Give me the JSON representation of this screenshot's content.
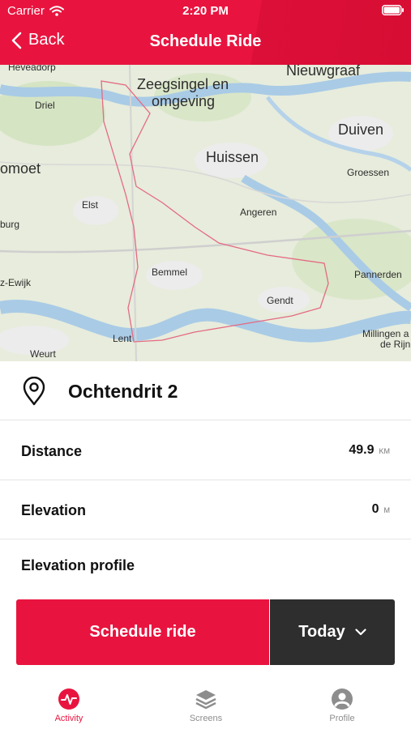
{
  "status_bar": {
    "carrier": "Carrier",
    "time": "2:20 PM"
  },
  "nav": {
    "back_label": "Back",
    "title": "Schedule Ride"
  },
  "map": {
    "places": [
      "Heveadorp",
      "Zeegsingel en",
      "omgeving",
      "Nieuwgraaf",
      "Driel",
      "Duiven",
      "omoet",
      "Huissen",
      "Groessen",
      "Elst",
      "Angeren",
      "burg",
      "Bemmel",
      "Pannerden",
      "z-Ewijk",
      "Gendt",
      "Lent",
      "Millingen a",
      "de Rijn",
      "Weurt"
    ]
  },
  "route": {
    "name": "Ochtendrit 2"
  },
  "stats": {
    "distance": {
      "label": "Distance",
      "value": "49.9",
      "unit": "KM"
    },
    "elevation": {
      "label": "Elevation",
      "value": "0",
      "unit": "M"
    }
  },
  "elevation_profile_label": "Elevation profile",
  "actions": {
    "schedule_label": "Schedule ride",
    "date_label": "Today"
  },
  "tabs": [
    {
      "label": "Activity",
      "icon": "activity-icon",
      "active": true
    },
    {
      "label": "Screens",
      "icon": "layers-icon",
      "active": false
    },
    {
      "label": "Profile",
      "icon": "user-circle-icon",
      "active": false
    }
  ],
  "colors": {
    "accent": "#e8143f",
    "dark_button": "#2e2e2e",
    "inactive_tab": "#8d8d8d"
  }
}
